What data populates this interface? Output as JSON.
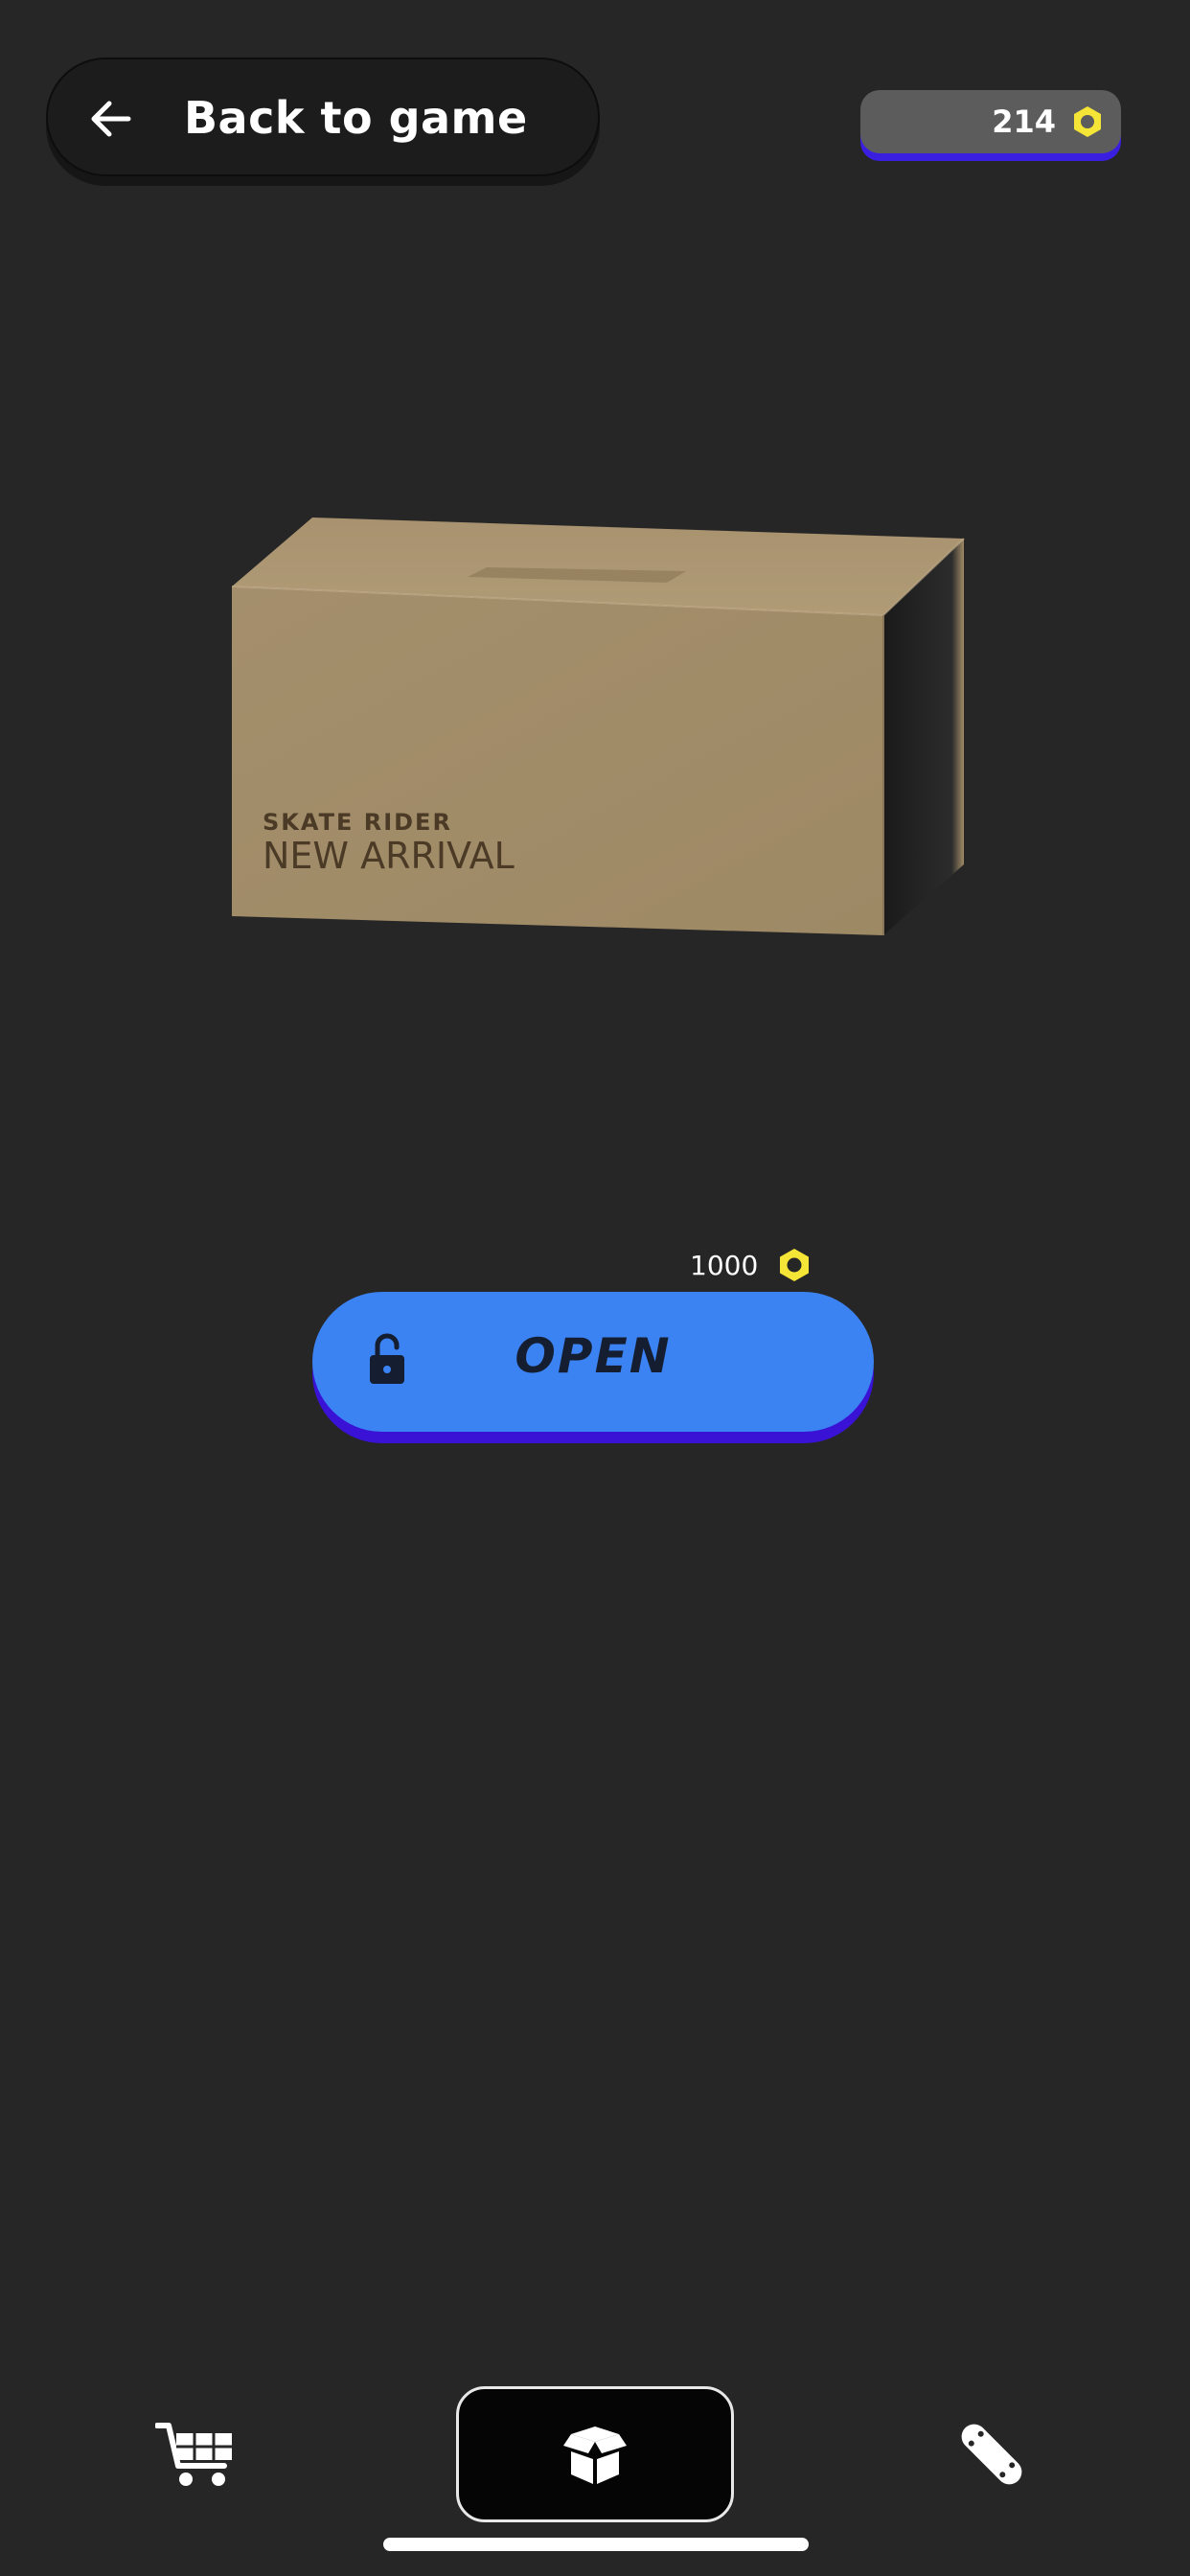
{
  "header": {
    "back_label": "Back to game",
    "coin_count": "214"
  },
  "box": {
    "brand": "SKATE RIDER",
    "title": "NEW ARRIVAL"
  },
  "open_action": {
    "price": "1000",
    "label": "OPEN"
  },
  "icons": {
    "back": "arrow-left-icon",
    "coin": "hex-nut-icon",
    "lock": "unlocked-padlock-icon",
    "nav_shop": "shopping-cart-icon",
    "nav_box": "open-box-icon",
    "nav_board": "skateboard-icon"
  },
  "colors": {
    "background": "#262626",
    "accent_blue": "#3b82f2",
    "accent_shadow": "#3a12d6",
    "coin_yellow": "#f5e536"
  },
  "bottom_nav": {
    "selected": "nav_box"
  }
}
